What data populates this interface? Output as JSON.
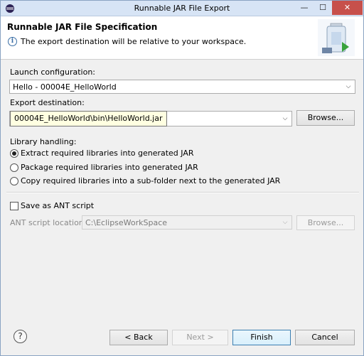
{
  "window": {
    "title": "Runnable JAR File Export",
    "minimize_glyph": "—",
    "maximize_glyph": "☐",
    "close_glyph": "✕"
  },
  "header": {
    "title": "Runnable JAR File Specification",
    "message": "The export destination will be relative to your workspace.",
    "info_icon": "info-icon",
    "graphic": "jar-export-icon"
  },
  "launch": {
    "label": "Launch configuration:",
    "value": "Hello - 00004E_HelloWorld"
  },
  "export": {
    "label": "Export destination:",
    "value": "00004E_HelloWorld\\bin\\HelloWorld.jar",
    "browse_label": "Browse..."
  },
  "library": {
    "label": "Library handling:",
    "options": [
      {
        "label": "Extract required libraries into generated JAR",
        "selected": true
      },
      {
        "label": "Package required libraries into generated JAR",
        "selected": false
      },
      {
        "label": "Copy required libraries into a sub-folder next to the generated JAR",
        "selected": false
      }
    ]
  },
  "ant": {
    "save_label": "Save as ANT script",
    "save_checked": false,
    "location_label": "ANT script location:",
    "location_value": "C:\\EclipseWorkSpace",
    "browse_label": "Browse..."
  },
  "footer": {
    "help_glyph": "?",
    "back_label": "< Back",
    "next_label": "Next >",
    "finish_label": "Finish",
    "cancel_label": "Cancel"
  }
}
